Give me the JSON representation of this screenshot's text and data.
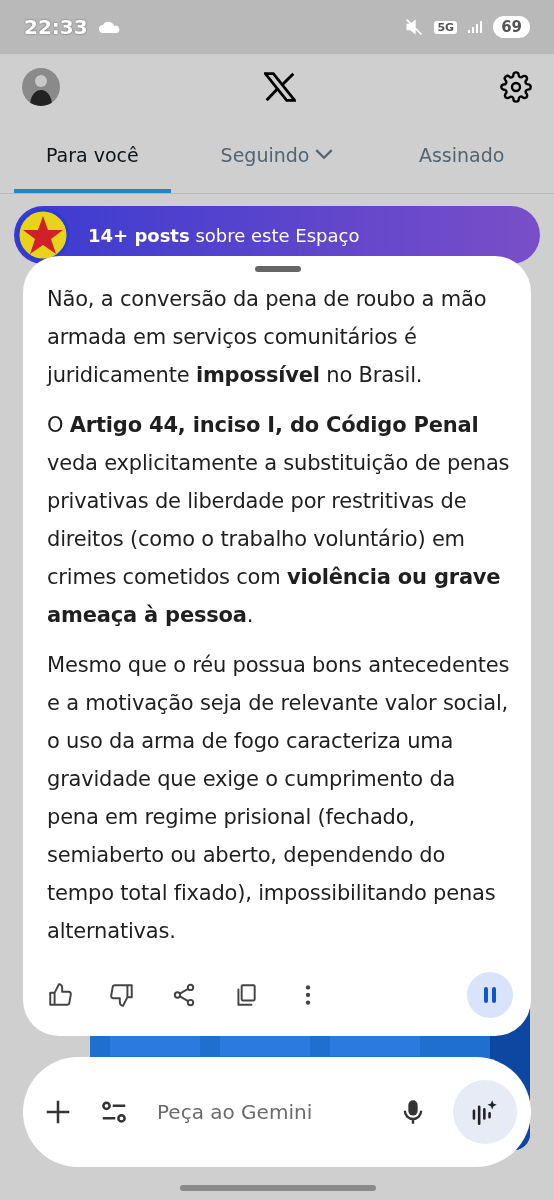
{
  "status_bar": {
    "time": "22:33",
    "network": "5G",
    "battery": "69"
  },
  "tabs": [
    {
      "label": "Para você",
      "selected": true,
      "has_menu": false
    },
    {
      "label": "Seguindo",
      "selected": false,
      "has_menu": true
    },
    {
      "label": "Assinado",
      "selected": false,
      "has_menu": false
    }
  ],
  "space_banner": {
    "text": "**14+ posts** sobre este Espaço"
  },
  "answer": {
    "paragraphs": [
      "Não, a conversão da pena de roubo a mão armada em serviços comunitários é juridicamente **impossível** no Brasil.",
      "O **Artigo 44, inciso I, do Código Penal** veda explicitamente a substituição de penas privativas de liberdade por restritivas de direitos (como o trabalho voluntário) em crimes cometidos com **violência ou grave ameaça à pessoa**.",
      "Mesmo que o réu possua bons antecedentes e a motivação seja de relevante valor social, o uso da arma de fogo caracteriza uma gravidade que exige o cumprimento da pena em regime prisional (fechado, semiaberto ou aberto, dependendo do tempo total fixado), impossibilitando penas alternativas."
    ],
    "playing": true
  },
  "composer": {
    "placeholder": "Peça ao Gemini"
  }
}
